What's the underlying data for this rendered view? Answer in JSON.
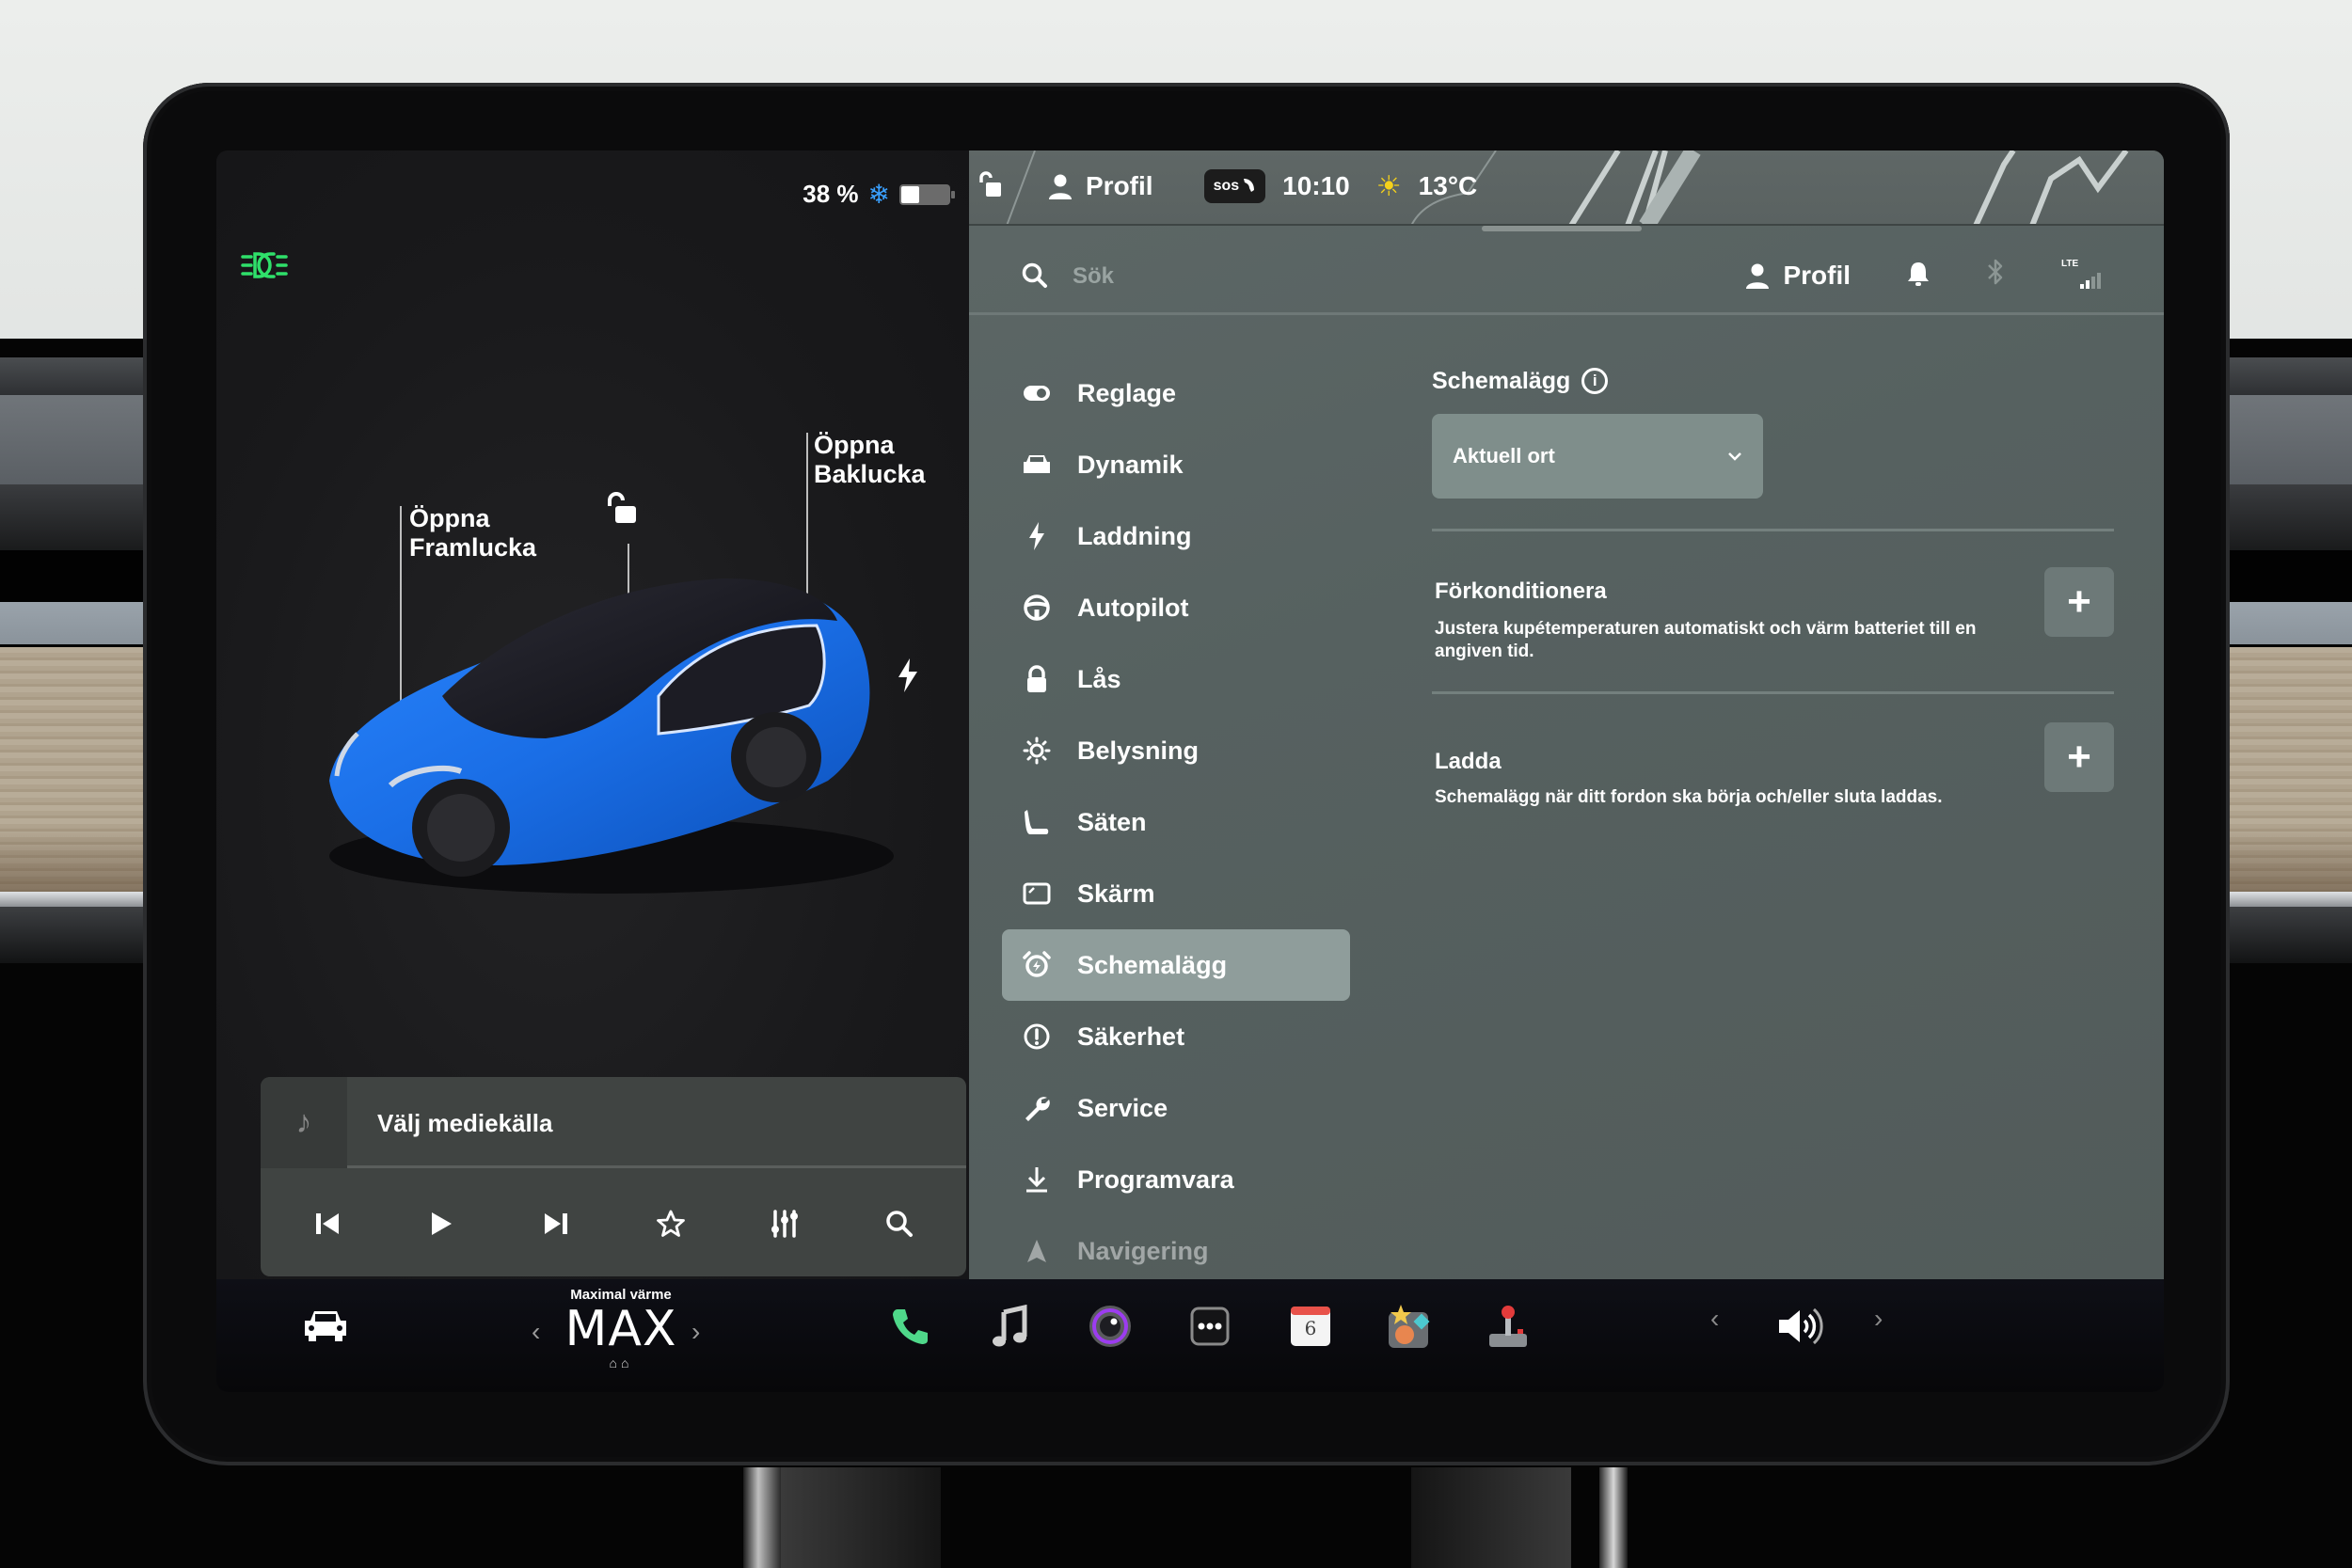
{
  "status_left": {
    "battery_percent_label": "38 %",
    "battery_level": 0.38,
    "snowflake_icon": "snowflake-icon",
    "headlight_icon": "headlight-icon"
  },
  "status_top": {
    "lock_icon": "unlocked-icon",
    "profile_label": "Profil",
    "sos_label": "SOS",
    "time": "10:10",
    "weather_icon": "sun-icon",
    "temperature": "13°C"
  },
  "car_view": {
    "frunk_label_line1": "Öppna",
    "frunk_label_line2": "Framlucka",
    "trunk_label_line1": "Öppna",
    "trunk_label_line2": "Baklucka",
    "lock_state_icon": "unlocked-icon",
    "charge_port_icon": "lightning-icon",
    "car_color": "#1a6ee6"
  },
  "media": {
    "source_label": "Välj mediekälla",
    "controls": [
      "previous",
      "play",
      "next",
      "favorite",
      "equalizer",
      "search"
    ]
  },
  "settings": {
    "search_placeholder": "Sök",
    "header_profile_label": "Profil",
    "header_icons": [
      "bell-icon",
      "bluetooth-icon",
      "lte-signal-icon"
    ],
    "lte_label": "LTE",
    "nav": [
      {
        "label": "Reglage",
        "icon": "toggle-icon"
      },
      {
        "label": "Dynamik",
        "icon": "car-icon"
      },
      {
        "label": "Laddning",
        "icon": "lightning-icon"
      },
      {
        "label": "Autopilot",
        "icon": "steering-wheel-icon"
      },
      {
        "label": "Lås",
        "icon": "lock-icon"
      },
      {
        "label": "Belysning",
        "icon": "light-icon"
      },
      {
        "label": "Säten",
        "icon": "seat-icon"
      },
      {
        "label": "Skärm",
        "icon": "display-icon"
      },
      {
        "label": "Schemalägg",
        "icon": "alarm-clock-icon",
        "active": true
      },
      {
        "label": "Säkerhet",
        "icon": "alert-icon"
      },
      {
        "label": "Service",
        "icon": "wrench-icon"
      },
      {
        "label": "Programvara",
        "icon": "download-icon"
      },
      {
        "label": "Navigering",
        "icon": "navigation-icon"
      }
    ],
    "content": {
      "title": "Schemalägg",
      "location_dropdown_value": "Aktuell ort",
      "rows": [
        {
          "title": "Förkonditionera",
          "description": "Justera kupétemperaturen automatiskt och värm batteriet till en angiven tid.",
          "action": "+"
        },
        {
          "title": "Ladda",
          "description": "Schemalägg när ditt fordon ska börja och/eller sluta laddas.",
          "action": "+"
        }
      ]
    }
  },
  "taskbar": {
    "climate_label": "Maximal värme",
    "climate_value": "MAX",
    "apps": [
      "phone-icon",
      "music-icon",
      "camera-icon",
      "more-icon",
      "calendar-icon",
      "toybox-icon",
      "arcade-icon"
    ],
    "calendar_day": "6",
    "volume_icon": "volume-icon"
  }
}
